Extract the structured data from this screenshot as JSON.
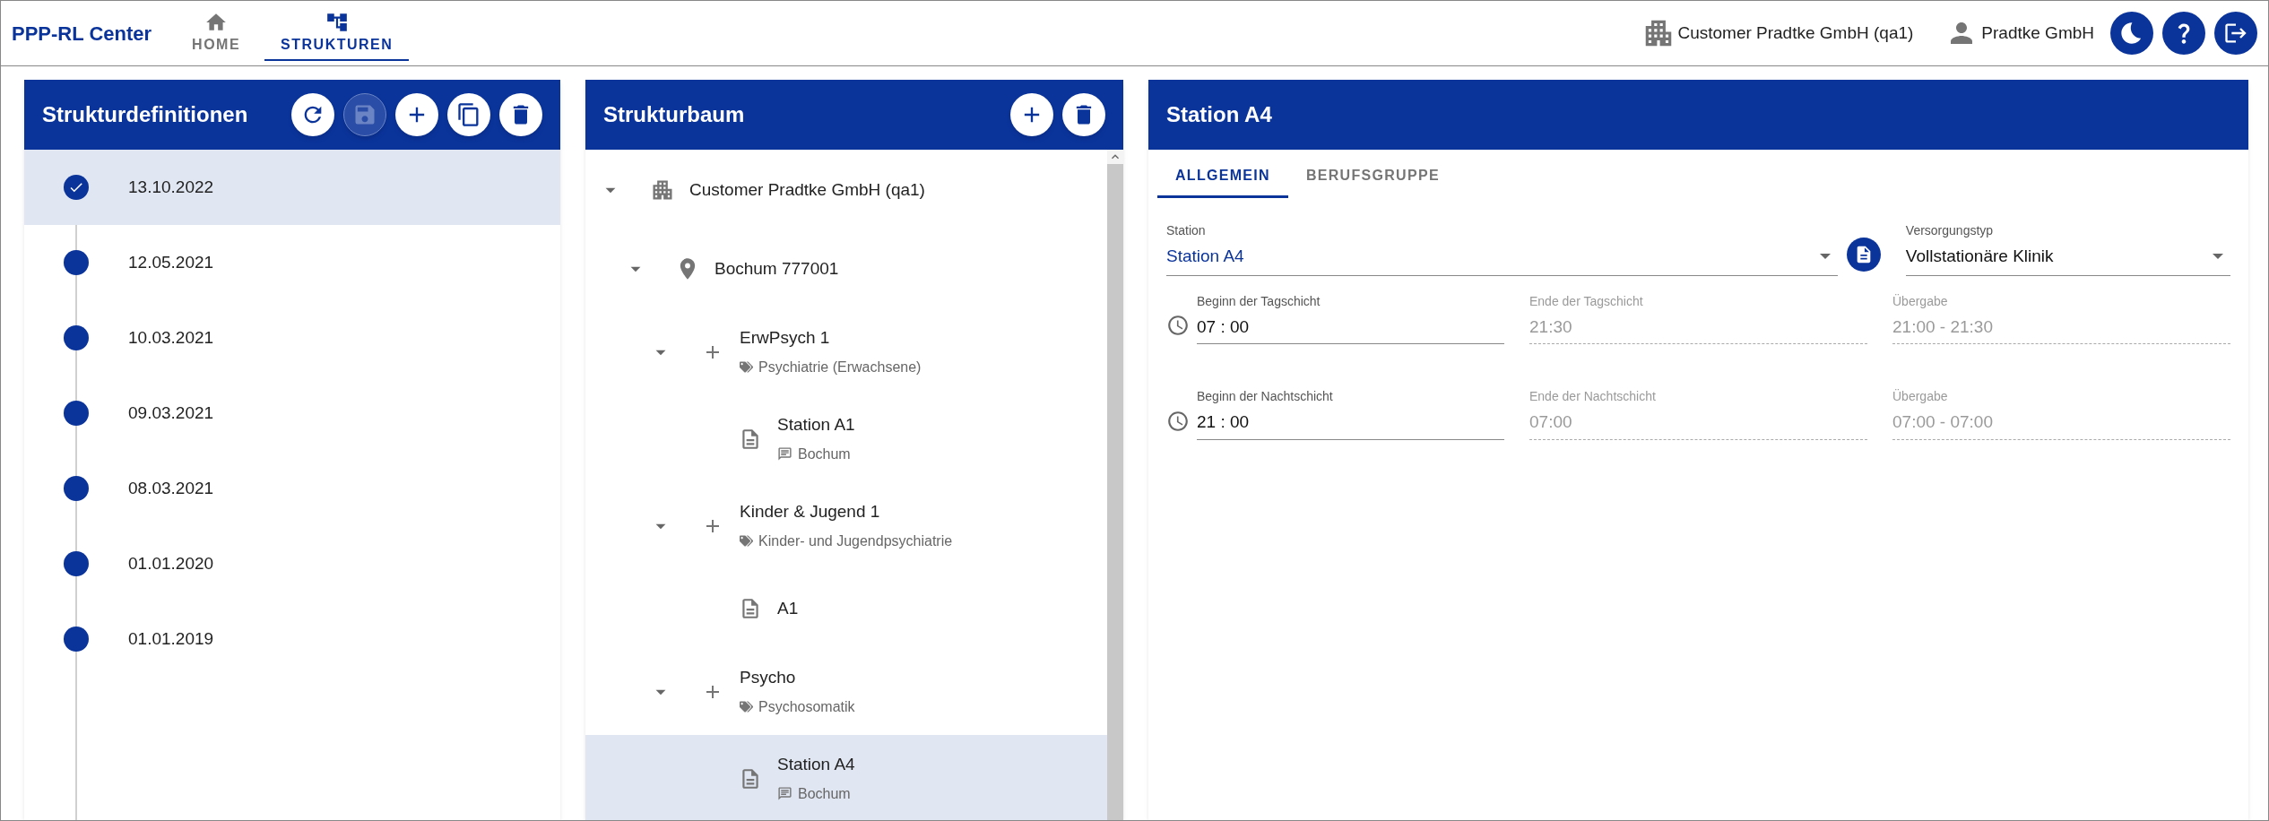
{
  "app": {
    "title": "PPP-RL Center"
  },
  "nav": [
    {
      "label": "HOME",
      "selected": false
    },
    {
      "label": "STRUKTUREN",
      "selected": true
    }
  ],
  "header": {
    "customer": "Customer Pradtke GmbH (qa1)",
    "user": "Pradtke GmbH"
  },
  "header_actions": [
    {
      "kind": "theme"
    },
    {
      "kind": "help"
    },
    {
      "kind": "logout"
    }
  ],
  "definitions": {
    "title": "Strukturdefinitionen",
    "actions": [
      {
        "kind": "refresh",
        "disabled": false
      },
      {
        "kind": "save",
        "disabled": true
      },
      {
        "kind": "add",
        "disabled": false
      },
      {
        "kind": "copy",
        "disabled": false
      },
      {
        "kind": "delete",
        "disabled": false
      }
    ],
    "items": [
      {
        "date": "13.10.2022",
        "selected": true
      },
      {
        "date": "12.05.2021",
        "selected": false
      },
      {
        "date": "10.03.2021",
        "selected": false
      },
      {
        "date": "09.03.2021",
        "selected": false
      },
      {
        "date": "08.03.2021",
        "selected": false
      },
      {
        "date": "01.01.2020",
        "selected": false
      },
      {
        "date": "01.01.2019",
        "selected": false
      }
    ]
  },
  "tree": {
    "title": "Strukturbaum",
    "actions": [
      {
        "kind": "add",
        "disabled": false
      },
      {
        "kind": "delete",
        "disabled": false
      }
    ],
    "nodes": [
      {
        "kind": "organization",
        "label": "Customer Pradtke GmbH (qa1)",
        "expanded": true,
        "selected": false,
        "children": [
          {
            "kind": "location",
            "label": "Bochum 777001",
            "expanded": true,
            "selected": false,
            "children": [
              {
                "kind": "department",
                "label": "ErwPsych 1",
                "subtitle": "Psychiatrie (Erwachsene)",
                "expanded": true,
                "selected": false,
                "children": [
                  {
                    "kind": "station",
                    "label": "Station A1",
                    "subtitle": "Bochum",
                    "selected": false
                  }
                ]
              },
              {
                "kind": "department",
                "label": "Kinder & Jugend 1",
                "subtitle": "Kinder- und Jugendpsychiatrie",
                "expanded": true,
                "selected": false,
                "children": [
                  {
                    "kind": "station",
                    "label": "A1",
                    "selected": false
                  }
                ]
              },
              {
                "kind": "department",
                "label": "Psycho",
                "subtitle": "Psychosomatik",
                "expanded": true,
                "selected": false,
                "children": [
                  {
                    "kind": "station",
                    "label": "Station A4",
                    "subtitle": "Bochum",
                    "selected": true
                  }
                ]
              }
            ]
          }
        ]
      }
    ]
  },
  "detail": {
    "title": "Station A4",
    "tabs": [
      {
        "label": "ALLGEMEIN",
        "selected": true
      },
      {
        "label": "BERUFSGRUPPE",
        "selected": false
      }
    ],
    "station": {
      "label": "Station",
      "value": "Station A4"
    },
    "versorgungstyp": {
      "label": "Versorgungstyp",
      "value": "Vollstationäre Klinik"
    },
    "shifts": [
      {
        "start": {
          "label": "Beginn der Tagschicht",
          "value": "07 : 00",
          "disabled": false
        },
        "end": {
          "label": "Ende der Tagschicht",
          "value": "21:30",
          "disabled": true
        },
        "handover": {
          "label": "Übergabe",
          "value": "21:00 - 21:30",
          "disabled": true
        }
      },
      {
        "start": {
          "label": "Beginn der Nachtschicht",
          "value": "21 : 00",
          "disabled": false
        },
        "end": {
          "label": "Ende der Nachtschicht",
          "value": "07:00",
          "disabled": true
        },
        "handover": {
          "label": "Übergabe",
          "value": "07:00 - 07:00",
          "disabled": true
        }
      }
    ]
  }
}
